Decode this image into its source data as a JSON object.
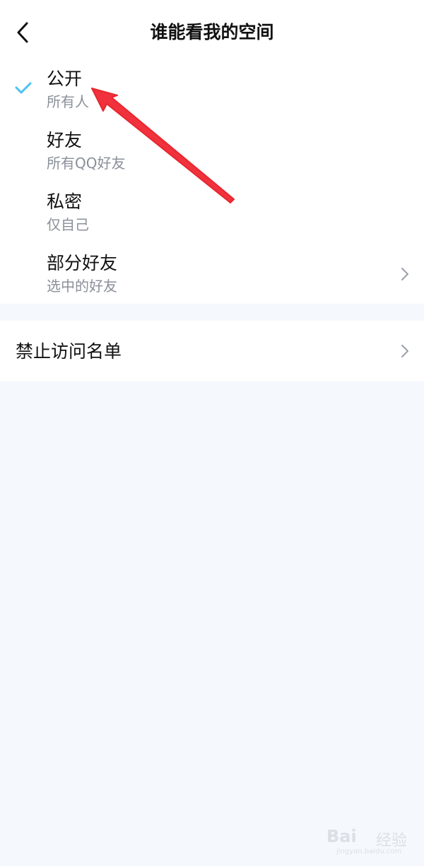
{
  "header": {
    "title": "谁能看我的空间",
    "back_icon": "chevron-left-icon"
  },
  "options": [
    {
      "label": "公开",
      "sub": "所有人",
      "selected": true
    },
    {
      "label": "好友",
      "sub": "所有QQ好友",
      "selected": false
    },
    {
      "label": "私密",
      "sub": "仅自己",
      "selected": false
    },
    {
      "label": "部分好友",
      "sub": "选中的好友",
      "selected": false,
      "has_chevron": true
    }
  ],
  "blocklist": {
    "label": "禁止访问名单"
  },
  "colors": {
    "check": "#4cc2f0",
    "annotation_arrow": "#f0323c",
    "page_bg": "#f5f8fd"
  },
  "watermark": {
    "brand": "Bai",
    "brand_cn": "经验",
    "url": "jingyan.baidu.com"
  }
}
